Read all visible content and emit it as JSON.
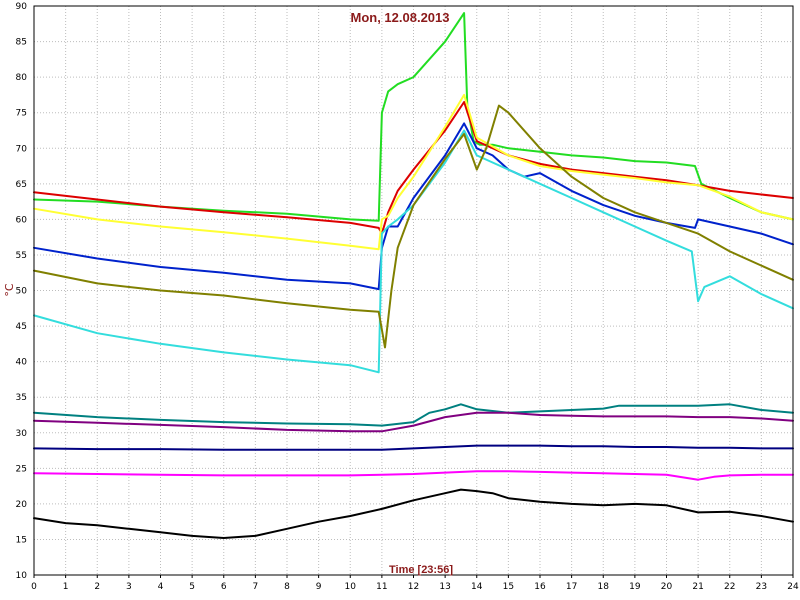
{
  "chart_data": {
    "type": "line",
    "title": "Mon, 12.08.2013",
    "xlabel": "Time [23:56]",
    "ylabel": "°C",
    "xlim": [
      0,
      24
    ],
    "ylim": [
      10,
      90
    ],
    "x_ticks": [
      0,
      1,
      2,
      3,
      4,
      5,
      6,
      7,
      8,
      9,
      10,
      11,
      12,
      13,
      14,
      15,
      16,
      17,
      18,
      19,
      20,
      21,
      22,
      23,
      24
    ],
    "y_ticks": [
      10,
      15,
      20,
      25,
      30,
      35,
      40,
      45,
      50,
      55,
      60,
      65,
      70,
      75,
      80,
      85,
      90
    ],
    "grid": true,
    "legend": "none",
    "series": [
      {
        "color": "#22dd22",
        "x": [
          0,
          2,
          4,
          6,
          8,
          10,
          10.9,
          11.0,
          11.2,
          11.5,
          12,
          13,
          13.6,
          13.7,
          13.9,
          14.1,
          14.5,
          15,
          16,
          17,
          18,
          19,
          20,
          20.9,
          21.1,
          22,
          23,
          24
        ],
        "y": [
          62.8,
          62.5,
          61.8,
          61.2,
          60.8,
          60.0,
          59.8,
          75,
          78,
          79,
          80,
          85,
          89,
          76,
          71,
          70.5,
          70.5,
          70,
          69.5,
          69,
          68.7,
          68.2,
          68,
          67.5,
          65,
          63,
          61,
          60
        ]
      },
      {
        "color": "#dd0000",
        "x": [
          0,
          2,
          4,
          6,
          8,
          10,
          10.9,
          11.0,
          11.2,
          11.5,
          12,
          13,
          13.6,
          14,
          15,
          16,
          17,
          18,
          19,
          20,
          21,
          22,
          23,
          24
        ],
        "y": [
          63.8,
          62.8,
          61.8,
          61,
          60.3,
          59.5,
          58.8,
          58,
          61,
          64,
          67,
          72.5,
          76.5,
          71,
          69,
          67.8,
          67,
          66.5,
          66,
          65.5,
          64.8,
          64,
          63.5,
          63
        ]
      },
      {
        "color": "#ffff33",
        "x": [
          0,
          2,
          4,
          6,
          8,
          10,
          10.9,
          11.0,
          11.2,
          11.5,
          12,
          13,
          13.6,
          14,
          15,
          16,
          17,
          18,
          19,
          20,
          21,
          22,
          23,
          24
        ],
        "y": [
          61.5,
          60,
          59,
          58.2,
          57.3,
          56.3,
          55.8,
          60,
          60.5,
          63,
          66,
          73,
          77.5,
          71.5,
          69,
          67.5,
          66.8,
          66.3,
          65.8,
          65.2,
          64.8,
          63.2,
          61,
          60
        ]
      },
      {
        "color": "#0022cc",
        "x": [
          0,
          2,
          4,
          6,
          8,
          10,
          10.9,
          11.0,
          11.2,
          11.5,
          12,
          13,
          13.6,
          14,
          14.5,
          15,
          15.5,
          16,
          17,
          18,
          19,
          20,
          20.9,
          21,
          22,
          23,
          24
        ],
        "y": [
          56,
          54.5,
          53.3,
          52.5,
          51.5,
          51,
          50.2,
          56,
          59,
          59,
          63,
          69,
          73.5,
          70,
          69,
          67,
          66,
          66.5,
          64,
          62,
          60.5,
          59.5,
          58.8,
          60,
          59,
          58,
          56.5
        ]
      },
      {
        "color": "#33dddd",
        "x": [
          0,
          2,
          4,
          6,
          8,
          10,
          10.9,
          11.0,
          11.2,
          11.5,
          12,
          13,
          13.6,
          14,
          15,
          16,
          17,
          18,
          19,
          20,
          20.8,
          21,
          21.2,
          22,
          23,
          24
        ],
        "y": [
          46.5,
          44,
          42.5,
          41.3,
          40.3,
          39.5,
          38.5,
          58,
          59,
          60,
          62,
          68,
          72.5,
          69,
          67,
          65,
          63,
          61,
          59,
          57,
          55.5,
          48.5,
          50.5,
          52,
          49.5,
          47.5
        ]
      },
      {
        "color": "#808000",
        "x": [
          0,
          2,
          4,
          6,
          8,
          10,
          10.9,
          11.1,
          11.3,
          11.5,
          12,
          13,
          13.6,
          14,
          14.3,
          14.7,
          15,
          16,
          17,
          18,
          19,
          20,
          21,
          22,
          23,
          24
        ],
        "y": [
          52.8,
          51,
          50,
          49.3,
          48.2,
          47.3,
          47,
          42,
          50,
          56,
          62,
          68.5,
          72,
          67,
          70,
          76,
          75,
          70,
          66,
          63,
          61,
          59.5,
          58,
          55.5,
          53.5,
          51.5
        ]
      },
      {
        "color": "#008080",
        "x": [
          0,
          2,
          4,
          6,
          8,
          10,
          11,
          12,
          12.5,
          13,
          13.5,
          14,
          15,
          16,
          17,
          18,
          18.5,
          19,
          20,
          21,
          22,
          23,
          24
        ],
        "y": [
          32.8,
          32.2,
          31.8,
          31.5,
          31.3,
          31.2,
          31,
          31.5,
          32.8,
          33.3,
          34,
          33.3,
          32.8,
          33,
          33.2,
          33.4,
          33.8,
          33.8,
          33.8,
          33.8,
          34,
          33.2,
          32.8
        ]
      },
      {
        "color": "#800080",
        "x": [
          0,
          2,
          4,
          6,
          8,
          10,
          11,
          12,
          13,
          14,
          15,
          16,
          17,
          18,
          19,
          20,
          21,
          22,
          23,
          24
        ],
        "y": [
          31.7,
          31.4,
          31.1,
          30.8,
          30.4,
          30.2,
          30.2,
          31,
          32.2,
          32.8,
          32.8,
          32.5,
          32.4,
          32.3,
          32.3,
          32.3,
          32.2,
          32.2,
          32,
          31.7
        ]
      },
      {
        "color": "#000080",
        "x": [
          0,
          2,
          4,
          6,
          8,
          10,
          11,
          12,
          13,
          14,
          15,
          16,
          17,
          18,
          19,
          20,
          21,
          22,
          23,
          24
        ],
        "y": [
          27.8,
          27.7,
          27.7,
          27.6,
          27.6,
          27.6,
          27.6,
          27.8,
          28,
          28.2,
          28.2,
          28.2,
          28.1,
          28.1,
          28,
          28,
          27.9,
          27.9,
          27.8,
          27.8
        ]
      },
      {
        "color": "#ff00ff",
        "x": [
          0,
          2,
          4,
          6,
          8,
          10,
          11,
          12,
          13,
          14,
          15,
          16,
          17,
          18,
          19,
          20,
          21,
          21.5,
          22,
          23,
          24
        ],
        "y": [
          24.3,
          24.2,
          24.1,
          24,
          24,
          24,
          24.1,
          24.2,
          24.4,
          24.6,
          24.6,
          24.5,
          24.4,
          24.3,
          24.2,
          24.1,
          23.4,
          23.8,
          24,
          24.1,
          24.1
        ]
      },
      {
        "color": "#000000",
        "x": [
          0,
          1,
          2,
          3,
          4,
          5,
          6,
          7,
          8,
          9,
          10,
          11,
          12,
          13,
          13.5,
          14,
          14.5,
          15,
          16,
          17,
          18,
          19,
          20,
          21,
          22,
          23,
          24
        ],
        "y": [
          18,
          17.3,
          17,
          16.5,
          16,
          15.5,
          15.2,
          15.5,
          16.5,
          17.5,
          18.3,
          19.3,
          20.5,
          21.5,
          22,
          21.8,
          21.5,
          20.8,
          20.3,
          20,
          19.8,
          20,
          19.8,
          18.8,
          18.9,
          18.3,
          17.5
        ]
      }
    ]
  }
}
